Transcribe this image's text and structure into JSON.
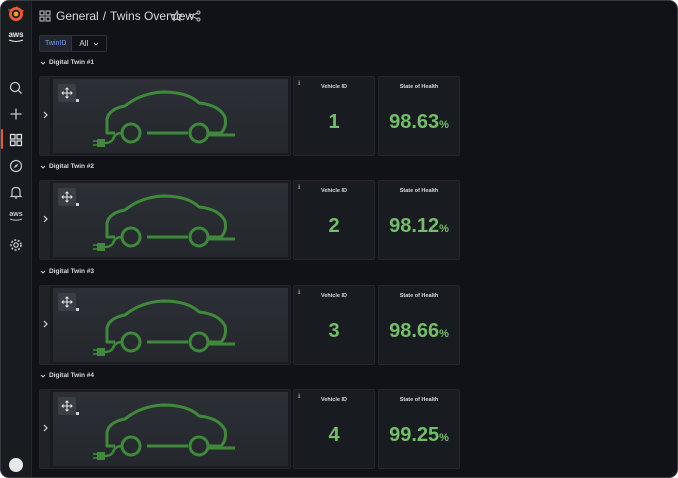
{
  "header": {
    "folder": "General",
    "separator": "/",
    "title": "Twins Overview"
  },
  "sidebar": {
    "aws_label": "aws",
    "aws_small_label": "aws"
  },
  "variables": {
    "label": "TwinID",
    "value": "All"
  },
  "rows": [
    {
      "title": "Digital Twin #1",
      "vehicle_label": "Vehicle ID",
      "vehicle_id": "1",
      "soh_label": "State of Health",
      "soh_value": "98.63",
      "soh_unit": "%"
    },
    {
      "title": "Digital Twin #2",
      "vehicle_label": "Vehicle ID",
      "vehicle_id": "2",
      "soh_label": "State of Health",
      "soh_value": "98.12",
      "soh_unit": "%"
    },
    {
      "title": "Digital Twin #3",
      "vehicle_label": "Vehicle ID",
      "vehicle_id": "3",
      "soh_label": "State of Health",
      "soh_value": "98.66",
      "soh_unit": "%"
    },
    {
      "title": "Digital Twin #4",
      "vehicle_label": "Vehicle ID",
      "vehicle_id": "4",
      "soh_label": "State of Health",
      "soh_value": "99.25",
      "soh_unit": "%"
    }
  ],
  "colors": {
    "accent": "#f05a28",
    "value_green": "#73bf69",
    "car_green": "#3f8a3a",
    "background": "#111217",
    "panel": "#181b1f"
  },
  "icons": [
    "grafana-logo-icon",
    "search-icon",
    "plus-icon",
    "dashboards-icon",
    "explore-icon",
    "alert-bell-icon",
    "aws-icon",
    "gear-icon",
    "apps-icon",
    "star-icon",
    "share-icon",
    "move-icon",
    "chevron-right-icon",
    "chevron-down-icon",
    "info-icon",
    "ev-car-icon"
  ]
}
